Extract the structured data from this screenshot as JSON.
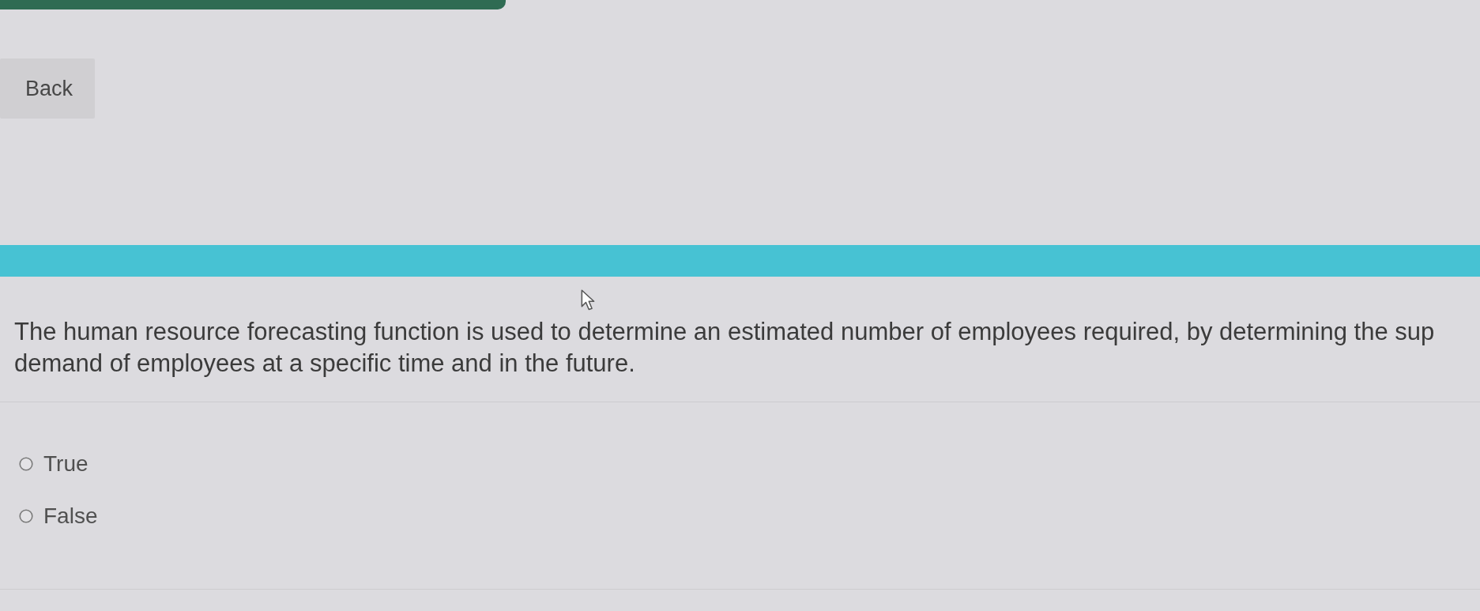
{
  "back_button": {
    "label": "Back"
  },
  "question": {
    "lines": [
      "The human resource forecasting function is used to determine an estimated number of employees required, by determining the sup",
      "demand of employees at a specific time and in the future."
    ]
  },
  "options": [
    {
      "label": "True",
      "selected": false
    },
    {
      "label": "False",
      "selected": false
    }
  ]
}
